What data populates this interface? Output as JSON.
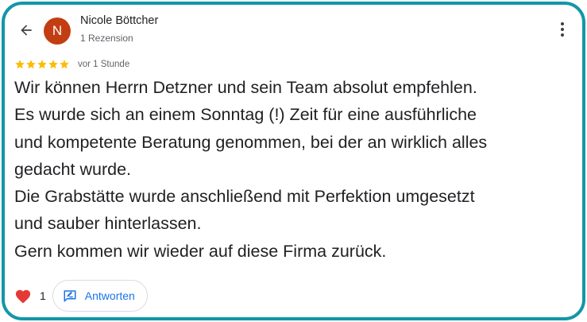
{
  "review": {
    "author": {
      "initial": "N",
      "name": "Nicole Böttcher",
      "meta": "1 Rezension",
      "avatar_color": "#c33d12"
    },
    "rating": 5,
    "star_color": "#fbbc04",
    "time": "vor 1 Stunde",
    "text_lines": [
      "Wir können Herrn Detzner und sein Team absolut empfehlen.",
      "Es wurde sich an einem Sonntag (!) Zeit für eine ausführliche",
      "und kompetente Beratung genommen, bei der an wirklich alles",
      "gedacht wurde.",
      "Die Grabstätte wurde anschließend mit Perfektion umgesetzt",
      "und sauber hinterlassen.",
      "Gern kommen wir wieder auf diese Firma zurück."
    ]
  },
  "actions": {
    "like_count": "1",
    "reply_label": "Antworten",
    "accent": "#1a73e8",
    "heart_color": "#e53935"
  },
  "icons": {
    "back": "arrow-back-icon",
    "more": "more-vert-icon",
    "heart": "heart-icon",
    "reply": "reply-icon"
  },
  "theme": {
    "frame_border": "#1297a8"
  }
}
